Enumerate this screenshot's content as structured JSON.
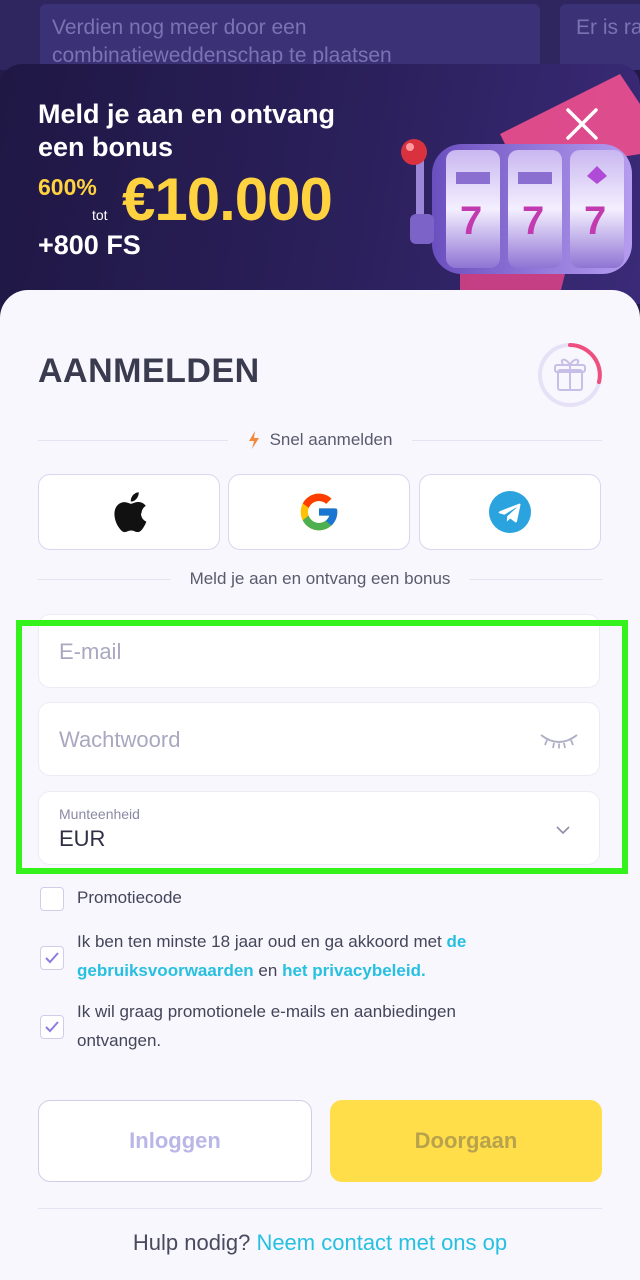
{
  "background": {
    "text_left": "Verdien nog meer door een combinatieweddenschap te plaatsen",
    "text_right": "Er is rakel"
  },
  "banner": {
    "title": "Meld je aan en ontvang een bonus",
    "bonus_percent": "600%",
    "bonus_tot": "tot",
    "bonus_amount": "€10.000",
    "bonus_fs": "+800 FS"
  },
  "form": {
    "title": "AANMELDEN",
    "quick_signup": "Snel aanmelden",
    "bonus_divider": "Meld je aan en ontvang een bonus",
    "email_placeholder": "E-mail",
    "password_placeholder": "Wachtwoord",
    "currency_label": "Munteenheid",
    "currency_value": "EUR",
    "promo_label": "Promotiecode",
    "terms": {
      "text_before": "Ik ben ten minste 18 jaar oud en ga akkoord met",
      "link_terms": "de gebruiksvoorwaarden",
      "text_and": "en",
      "link_privacy": "het privacybeleid."
    },
    "marketing_label": "Ik wil graag promotionele e-mails en aanbiedingen ontvangen.",
    "login_button": "Inloggen",
    "continue_button": "Doorgaan",
    "help_text": "Hulp nodig?",
    "help_link": "Neem contact met ons op"
  },
  "state": {
    "promo_checked": false,
    "terms_checked": true,
    "marketing_checked": true
  },
  "colors": {
    "accent_yellow": "#ffd23f",
    "link_cyan": "#28c0e0",
    "highlight_green": "#35f21c"
  },
  "icons": [
    "close-icon",
    "apple-icon",
    "google-icon",
    "telegram-icon",
    "gift-icon",
    "lightning-icon",
    "eye-closed-icon",
    "chevron-down-icon",
    "check-icon"
  ]
}
